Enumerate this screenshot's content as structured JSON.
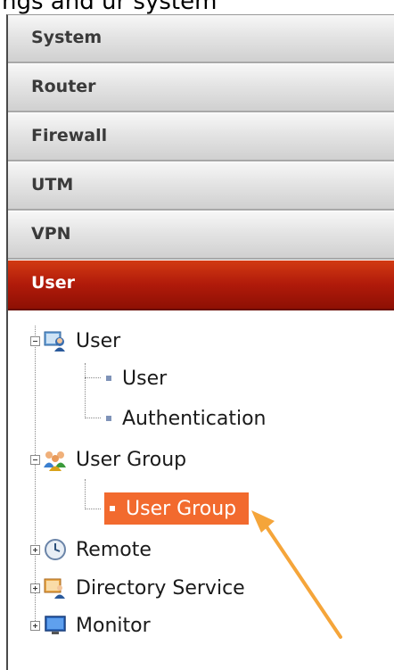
{
  "header_fragment": "ngs and ur system",
  "menu": {
    "sections": [
      {
        "label": "System"
      },
      {
        "label": "Router"
      },
      {
        "label": "Firewall"
      },
      {
        "label": "UTM"
      },
      {
        "label": "VPN"
      },
      {
        "label": "User"
      }
    ],
    "active": "User"
  },
  "tree": {
    "user": {
      "label": "User",
      "children": [
        "User",
        "Authentication"
      ]
    },
    "user_group": {
      "label": "User Group",
      "children": [
        "User Group"
      ]
    },
    "remote": {
      "label": "Remote"
    },
    "directory_service": {
      "label": "Directory Service"
    },
    "monitor": {
      "label": "Monitor"
    }
  },
  "selected_item": "User Group",
  "colors": {
    "active_menu": "#b01a0a",
    "selection": "#f26a2e",
    "arrow": "#f5a53a"
  }
}
